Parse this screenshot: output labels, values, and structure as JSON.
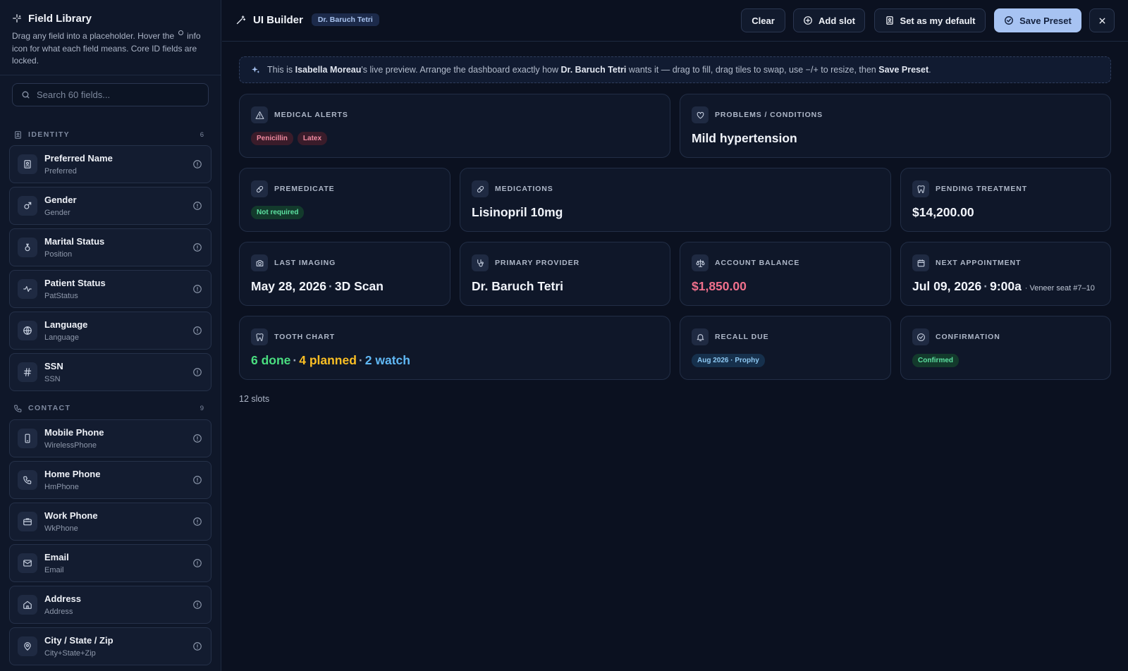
{
  "sidebar": {
    "title": "Field Library",
    "description_before": "Drag any field into a placeholder. Hover the",
    "description_after": "info icon for what each field means. Core ID fields are locked.",
    "search_placeholder": "Search 60 fields...",
    "groups": [
      {
        "name": "IDENTITY",
        "count": "6",
        "icon": "id-badge-icon",
        "fields": [
          {
            "label": "Preferred Name",
            "sub": "Preferred",
            "icon": "id-badge-icon"
          },
          {
            "label": "Gender",
            "sub": "Gender",
            "icon": "gender-icon"
          },
          {
            "label": "Marital Status",
            "sub": "Position",
            "icon": "ring-icon"
          },
          {
            "label": "Patient Status",
            "sub": "PatStatus",
            "icon": "pulse-icon"
          },
          {
            "label": "Language",
            "sub": "Language",
            "icon": "globe-icon"
          },
          {
            "label": "SSN",
            "sub": "SSN",
            "icon": "hash-icon"
          }
        ]
      },
      {
        "name": "CONTACT",
        "count": "9",
        "icon": "phone-icon",
        "fields": [
          {
            "label": "Mobile Phone",
            "sub": "WirelessPhone",
            "icon": "mobile-icon"
          },
          {
            "label": "Home Phone",
            "sub": "HmPhone",
            "icon": "phone-icon"
          },
          {
            "label": "Work Phone",
            "sub": "WkPhone",
            "icon": "briefcase-icon"
          },
          {
            "label": "Email",
            "sub": "Email",
            "icon": "mail-icon"
          },
          {
            "label": "Address",
            "sub": "Address",
            "icon": "home-icon"
          },
          {
            "label": "City / State / Zip",
            "sub": "City+State+Zip",
            "icon": "map-pin-icon"
          }
        ]
      }
    ]
  },
  "topbar": {
    "title": "UI Builder",
    "badge": "Dr. Baruch Tetri",
    "clear_label": "Clear",
    "add_slot_label": "Add slot",
    "set_default_label": "Set as my default",
    "save_label": "Save Preset"
  },
  "banner": {
    "p1": "This is",
    "patient": "Isabella Moreau",
    "p2": "'s live preview. Arrange the dashboard exactly how",
    "doctor": "Dr. Baruch Tetri",
    "p3": "wants it — drag to fill, drag tiles to swap, use −/+ to resize, then",
    "action": "Save Preset",
    "p4": "."
  },
  "tiles": {
    "medical_alerts": {
      "label": "MEDICAL ALERTS",
      "chips": [
        "Penicillin",
        "Latex"
      ]
    },
    "problems": {
      "label": "PROBLEMS / CONDITIONS",
      "value": "Mild hypertension"
    },
    "premedicate": {
      "label": "PREMEDICATE",
      "chip": "Not required"
    },
    "medications": {
      "label": "MEDICATIONS",
      "value": "Lisinopril 10mg"
    },
    "pending_treatment": {
      "label": "PENDING TREATMENT",
      "value": "$14,200.00"
    },
    "last_imaging": {
      "label": "LAST IMAGING",
      "date": "May 28, 2026",
      "sep": "·",
      "type": "3D Scan"
    },
    "primary_provider": {
      "label": "PRIMARY PROVIDER",
      "value": "Dr. Baruch Tetri"
    },
    "account_balance": {
      "label": "ACCOUNT BALANCE",
      "value": "$1,850.00"
    },
    "next_appointment": {
      "label": "NEXT APPOINTMENT",
      "date": "Jul 09, 2026",
      "sep": "·",
      "time": "9:00a",
      "note": "· Veneer seat #7–10"
    },
    "tooth_chart": {
      "label": "TOOTH CHART",
      "done": "6 done",
      "planned": "4 planned",
      "watch": "2 watch",
      "sep": "·"
    },
    "recall_due": {
      "label": "RECALL DUE",
      "chip": "Aug 2026 · Prophy"
    },
    "confirmation": {
      "label": "CONFIRMATION",
      "chip": "Confirmed"
    }
  },
  "slots_count": "12 slots",
  "colors": {
    "background": "#0b1120",
    "accent": "#a7c3f2",
    "balance": "#f0708c",
    "done": "#4ade80",
    "planned": "#fbbf24",
    "watch": "#60b8f5"
  }
}
